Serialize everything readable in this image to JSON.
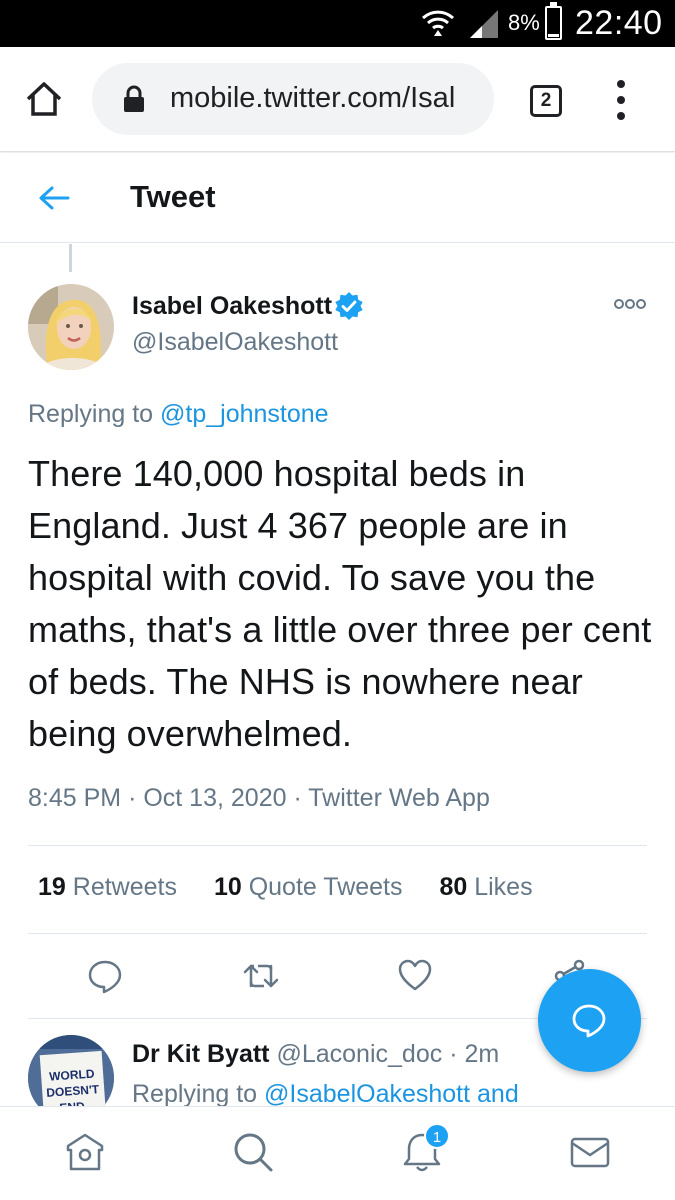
{
  "status_bar": {
    "battery": "8%",
    "time": "22:40",
    "battery_level": 0.08
  },
  "browser": {
    "url": "mobile.twitter.com/Isal",
    "tab_count": "2"
  },
  "header": {
    "title": "Tweet"
  },
  "tweet": {
    "author_name": "Isabel Oakeshott",
    "author_handle": "@IsabelOakeshott",
    "replying_prefix": "Replying to",
    "replying_to": "@tp_johnstone",
    "text": "There 140,000 hospital beds in England. Just 4 367 people are in hospital with covid. To save you the maths, that's a little over three per cent of beds. The NHS is nowhere near being overwhelmed.",
    "time": "8:45 PM",
    "date": "Oct 13, 2020",
    "source": "Twitter Web App",
    "retweets_count": "19",
    "retweets_label": "Retweets",
    "quotes_count": "10",
    "quotes_label": "Quote Tweets",
    "likes_count": "80",
    "likes_label": "Likes"
  },
  "reply": {
    "author_name": "Dr Kit Byatt",
    "author_handle": "@Laconic_doc",
    "time": "2m",
    "replying_prefix": "Replying to",
    "replying_to": "@IsabelOakeshott and",
    "avatar_text": "WORLD DOESN'T END"
  },
  "bottom_nav": {
    "notifications_badge": "1"
  },
  "colors": {
    "accent": "#1da1f2",
    "link": "#1b95e0",
    "text": "#14171a",
    "secondary": "#657786"
  }
}
